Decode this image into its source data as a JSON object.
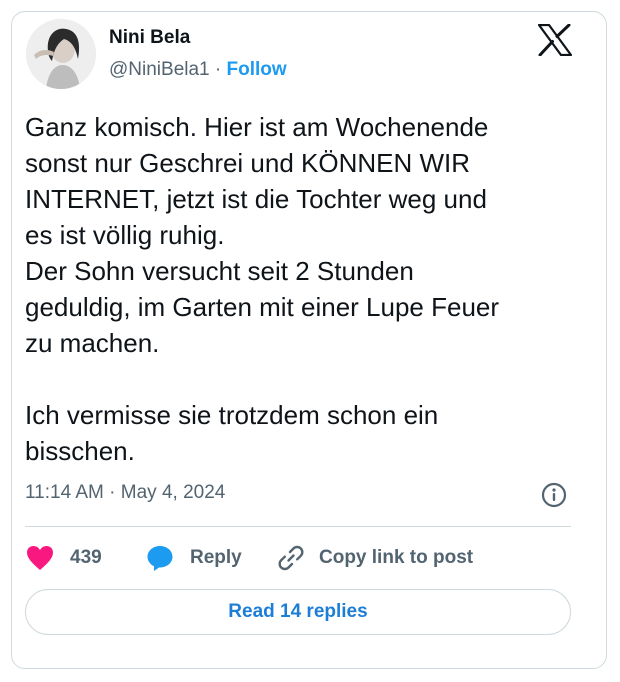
{
  "author": {
    "name": "Nini Bela",
    "handle": "@NiniBela1",
    "separator": "·",
    "follow_label": "Follow"
  },
  "header": {
    "logo_icon": "x-logo-icon"
  },
  "tweet": {
    "text": "Ganz komisch. Hier ist am Wochenende\nsonst  nur Geschrei und KÖNNEN WIR\nINTERNET, jetzt ist die Tochter weg und\nes ist völlig ruhig.\nDer Sohn versucht seit 2 Stunden\ngeduldig, im Garten mit einer Lupe Feuer\nzu machen.\n\nIch vermisse sie trotzdem schon ein\nbisschen.",
    "time": "11:14 AM",
    "meta_separator": "·",
    "date": "May 4, 2024",
    "info_icon": "info-icon"
  },
  "actions": {
    "like_icon": "heart-icon",
    "like_count": "439",
    "reply_icon": "speech-bubble-icon",
    "reply_label": "Reply",
    "copy_icon": "link-icon",
    "copy_label": "Copy link to post"
  },
  "footer": {
    "read_replies_label": "Read 14 replies"
  },
  "colors": {
    "accent": "#1d9bf0",
    "like": "#f91880",
    "secondary_text": "#536471",
    "border": "#cfd9de"
  }
}
